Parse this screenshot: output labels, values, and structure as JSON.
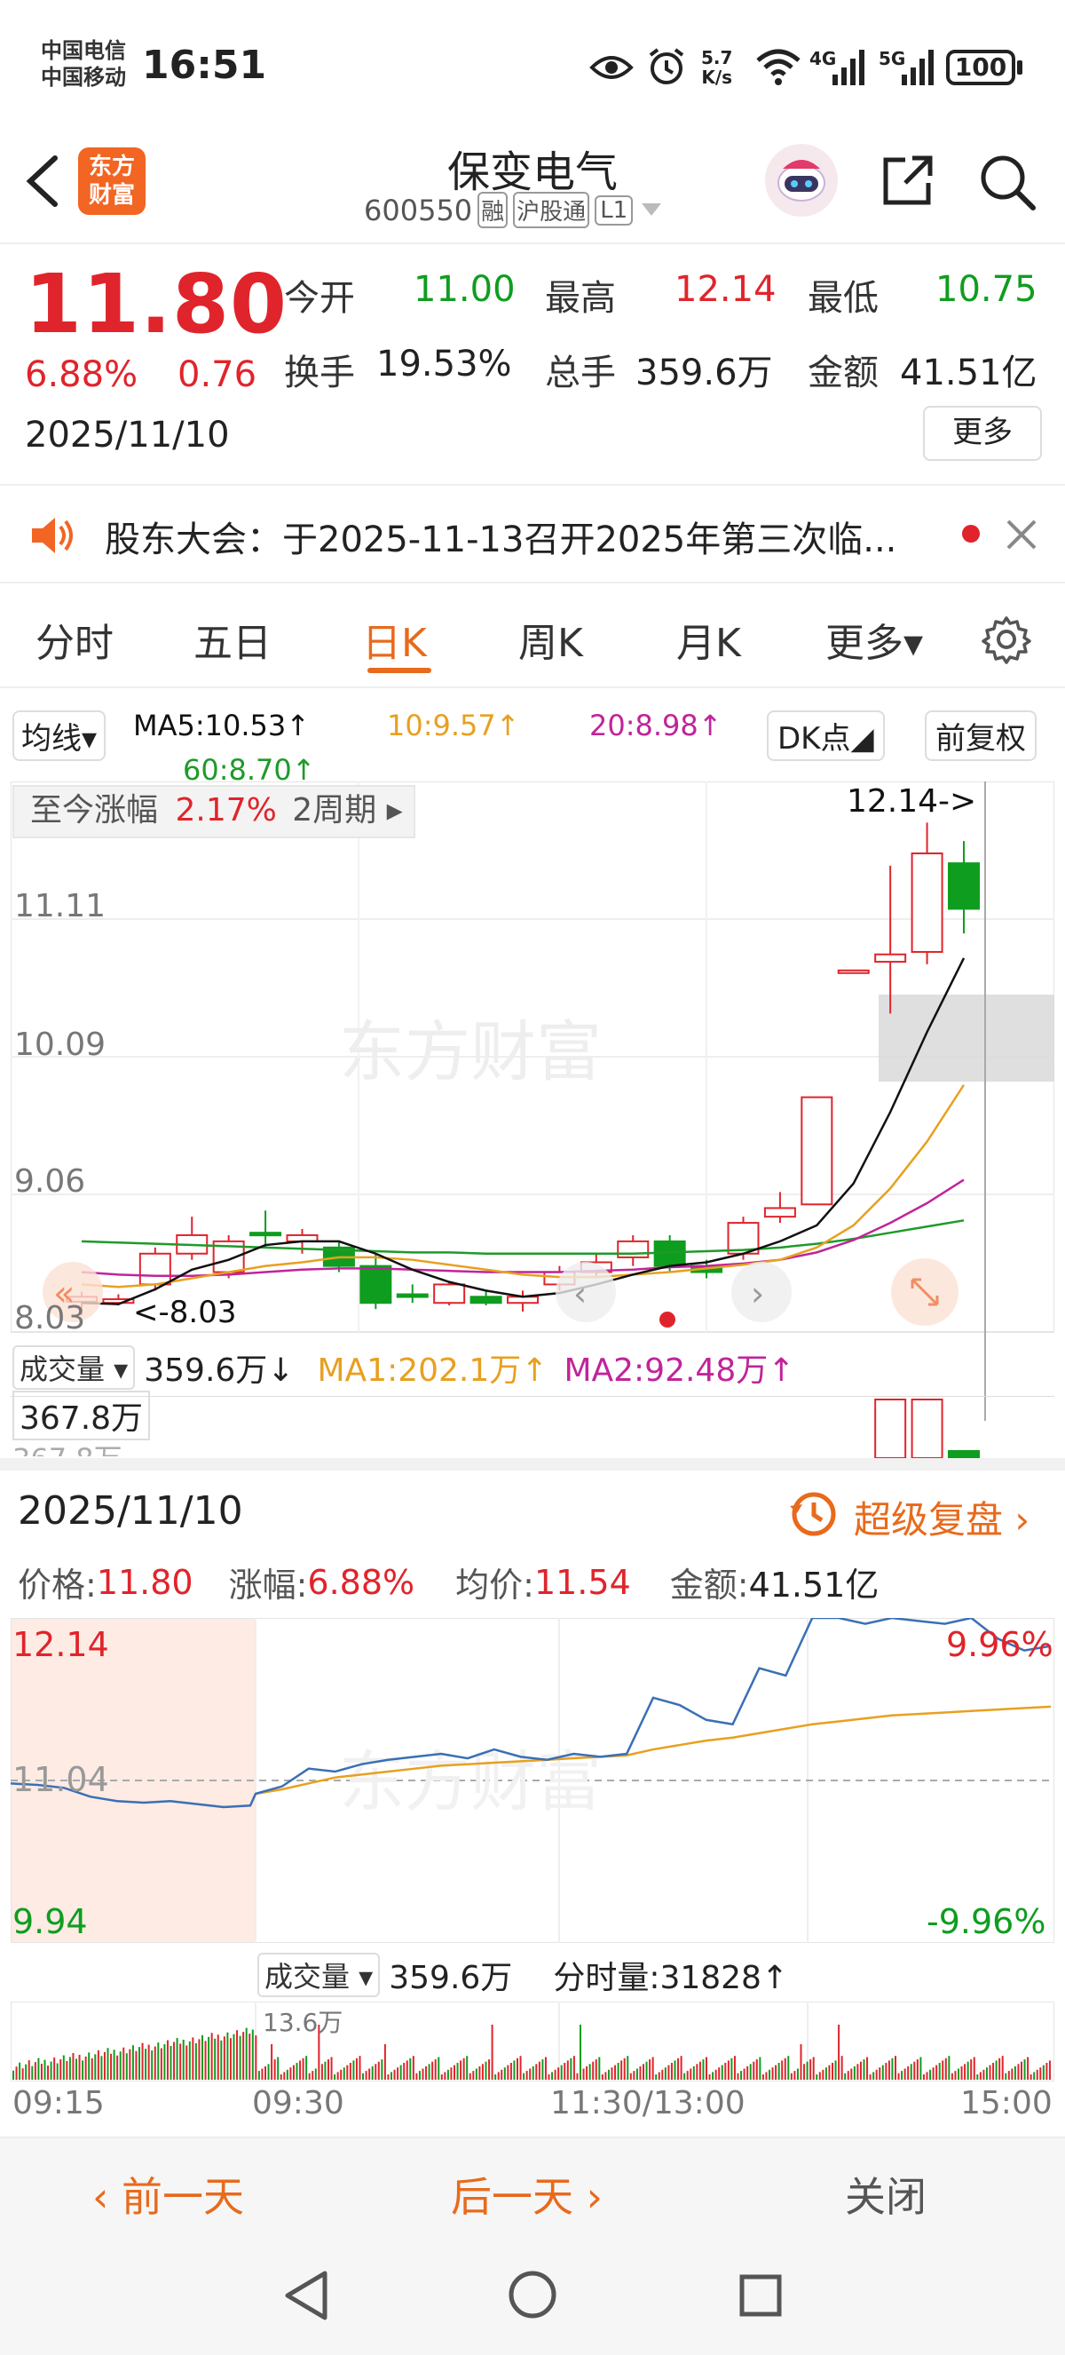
{
  "status_bar": {
    "carrier1": "中国电信",
    "carrier2": "中国移动",
    "time": "16:51",
    "net_speed_top": "5.7",
    "net_speed_bottom": "K/s",
    "sig1": "4G",
    "sig2": "5G",
    "battery": "100"
  },
  "header": {
    "logo_line1": "东方",
    "logo_line2": "财富",
    "stock_name": "保变电气",
    "stock_code": "600550",
    "tag_margin": "融",
    "tag_connect": "沪股通",
    "tag_level": "L1"
  },
  "quote": {
    "price": "11.80",
    "change_pct": "6.88%",
    "change_amt": "0.76",
    "date": "2025/11/10",
    "open_label": "今开",
    "open_value": "11.00",
    "high_label": "最高",
    "high_value": "12.14",
    "low_label": "最低",
    "low_value": "10.75",
    "turnover_label": "换手",
    "turnover_value": "19.53%",
    "volume_label": "总手",
    "volume_value": "359.6万",
    "amount_label": "金额",
    "amount_value": "41.51亿",
    "more_button": "更多"
  },
  "notice": {
    "text": "股东大会：于2025-11-13召开2025年第三次临..."
  },
  "tabs": {
    "items": [
      "分时",
      "五日",
      "日K",
      "周K",
      "月K",
      "更多▾"
    ],
    "active": "日K"
  },
  "kline": {
    "ma_selector": "均线▾",
    "ma5": "MA5:10.53↑",
    "ma10": "10:9.57↑",
    "ma20": "20:8.98↑",
    "ma60": "60:8.70↑",
    "dk_button": "DK点◢",
    "adjust_button": "前复权",
    "range_label": "至今涨幅",
    "range_value": "2.17%",
    "range_period": "2周期 ▸",
    "max_label": "12.14->",
    "min_label": "<-8.03",
    "y_labels": [
      "11.11",
      "10.09",
      "9.06",
      "8.03"
    ],
    "watermark": "东方财富",
    "vol_selector": "成交量 ▾",
    "vol_value": "359.6万↓",
    "vol_ma1": "MA1:202.1万↑",
    "vol_ma2": "MA2:92.48万↑",
    "vol_max": "367.8万",
    "vol_max_shadow": "367.8万",
    "colors": {
      "up": "#e0242b",
      "down": "#0f9d1f",
      "ma5": "#111111",
      "ma10": "#e8a020",
      "ma20": "#c0249a",
      "ma60": "#1f9a2a"
    }
  },
  "chart_data": {
    "type": "candlestick",
    "ylim": [
      8.03,
      12.14
    ],
    "candles": [
      {
        "o": 8.06,
        "c": 8.1,
        "h": 8.14,
        "l": 7.95
      },
      {
        "o": 8.05,
        "c": 8.08,
        "h": 8.12,
        "l": 8.03
      },
      {
        "o": 8.2,
        "c": 8.45,
        "h": 8.5,
        "l": 8.15
      },
      {
        "o": 8.45,
        "c": 8.6,
        "h": 8.75,
        "l": 8.4
      },
      {
        "o": 8.3,
        "c": 8.55,
        "h": 8.6,
        "l": 8.25
      },
      {
        "o": 8.62,
        "c": 8.6,
        "h": 8.8,
        "l": 8.5
      },
      {
        "o": 8.55,
        "c": 8.6,
        "h": 8.65,
        "l": 8.45
      },
      {
        "o": 8.5,
        "c": 8.35,
        "h": 8.55,
        "l": 8.3
      },
      {
        "o": 8.35,
        "c": 8.05,
        "h": 8.45,
        "l": 8.0
      },
      {
        "o": 8.12,
        "c": 8.1,
        "h": 8.2,
        "l": 8.05
      },
      {
        "o": 8.05,
        "c": 8.2,
        "h": 8.22,
        "l": 8.03
      },
      {
        "o": 8.1,
        "c": 8.05,
        "h": 8.15,
        "l": 8.03
      },
      {
        "o": 8.05,
        "c": 8.1,
        "h": 8.15,
        "l": 7.98
      },
      {
        "o": 8.2,
        "c": 8.3,
        "h": 8.35,
        "l": 8.15
      },
      {
        "o": 8.3,
        "c": 8.38,
        "h": 8.45,
        "l": 8.25
      },
      {
        "o": 8.42,
        "c": 8.55,
        "h": 8.6,
        "l": 8.35
      },
      {
        "o": 8.55,
        "c": 8.35,
        "h": 8.6,
        "l": 8.3
      },
      {
        "o": 8.35,
        "c": 8.3,
        "h": 8.4,
        "l": 8.25
      },
      {
        "o": 8.45,
        "c": 8.7,
        "h": 8.75,
        "l": 8.4
      },
      {
        "o": 8.75,
        "c": 8.82,
        "h": 8.95,
        "l": 8.7
      },
      {
        "o": 8.85,
        "c": 9.72,
        "h": 9.72,
        "l": 8.85
      },
      {
        "o": 10.75,
        "c": 10.75,
        "h": 10.75,
        "l": 10.75
      },
      {
        "o": 10.82,
        "c": 10.88,
        "h": 11.6,
        "l": 10.4
      },
      {
        "o": 10.9,
        "c": 11.7,
        "h": 11.95,
        "l": 10.8
      },
      {
        "o": 11.62,
        "c": 11.25,
        "h": 11.8,
        "l": 11.05
      }
    ],
    "ma5": [
      8.05,
      8.04,
      8.16,
      8.32,
      8.4,
      8.52,
      8.55,
      8.55,
      8.45,
      8.32,
      8.22,
      8.15,
      8.1,
      8.13,
      8.2,
      8.28,
      8.35,
      8.38,
      8.45,
      8.55,
      8.68,
      9.02,
      9.6,
      10.25,
      10.85
    ],
    "ma10": [
      8.2,
      8.18,
      8.2,
      8.25,
      8.3,
      8.35,
      8.38,
      8.42,
      8.42,
      8.4,
      8.36,
      8.32,
      8.28,
      8.26,
      8.26,
      8.28,
      8.3,
      8.33,
      8.36,
      8.4,
      8.5,
      8.68,
      8.98,
      9.36,
      9.82
    ],
    "ma20": [
      8.3,
      8.28,
      8.27,
      8.27,
      8.28,
      8.3,
      8.32,
      8.33,
      8.33,
      8.32,
      8.31,
      8.3,
      8.3,
      8.3,
      8.31,
      8.32,
      8.34,
      8.35,
      8.37,
      8.4,
      8.46,
      8.56,
      8.7,
      8.86,
      9.05
    ],
    "ma60": [
      8.55,
      8.54,
      8.53,
      8.52,
      8.51,
      8.5,
      8.49,
      8.48,
      8.47,
      8.46,
      8.46,
      8.45,
      8.45,
      8.45,
      8.45,
      8.45,
      8.46,
      8.47,
      8.48,
      8.5,
      8.53,
      8.57,
      8.62,
      8.67,
      8.72
    ],
    "volume_shown": [
      false,
      false,
      false,
      false,
      false,
      false,
      false,
      false,
      false,
      false,
      false,
      false,
      false,
      false,
      false,
      false,
      false,
      false,
      false,
      false,
      false,
      false,
      true,
      true,
      true
    ]
  },
  "minute": {
    "date": "2025/11/10",
    "replay_button": "超级复盘 ›",
    "price_label": "价格:",
    "price_value": "11.80",
    "chg_label": "涨幅:",
    "chg_value": "6.88%",
    "avg_label": "均价:",
    "avg_value": "11.54",
    "amt_label": "金额:",
    "amt_value": "41.51亿",
    "y_top": "12.14",
    "y_mid": "11.04",
    "y_bottom": "9.94",
    "pct_top": "9.96%",
    "pct_bottom": "-9.96%",
    "watermark": "东方财富",
    "vol_selector": "成交量 ▾",
    "vol_value": "359.6万",
    "tick_label": "分时量:31828↑",
    "vol_max": "13.6万",
    "time_labels": [
      "09:15",
      "09:30",
      "11:30/13:00",
      "15:00"
    ],
    "chart_data": {
      "type": "line",
      "ylim": [
        9.94,
        12.14
      ],
      "price": [
        11.02,
        11.01,
        10.99,
        10.93,
        10.9,
        10.89,
        10.9,
        10.88,
        10.86,
        10.87,
        10.95,
        11.0,
        11.12,
        11.1,
        11.15,
        11.18,
        11.2,
        11.22,
        11.19,
        11.25,
        11.2,
        11.18,
        11.22,
        11.2,
        11.22,
        11.6,
        11.55,
        11.45,
        11.42,
        11.8,
        11.75,
        12.14,
        12.14,
        12.1,
        12.14,
        12.12,
        12.1,
        12.14,
        12.0,
        11.92,
        11.95
      ],
      "average": [
        null,
        null,
        null,
        null,
        null,
        null,
        null,
        null,
        null,
        null,
        10.95,
        10.98,
        11.02,
        11.06,
        11.08,
        11.1,
        11.12,
        11.14,
        11.15,
        11.16,
        11.17,
        11.18,
        11.19,
        11.2,
        11.21,
        11.25,
        11.28,
        11.31,
        11.33,
        11.36,
        11.39,
        11.42,
        11.44,
        11.46,
        11.48,
        11.49,
        11.5,
        11.51,
        11.52,
        11.53,
        11.54
      ]
    }
  },
  "bottom": {
    "prev_day": "‹ 前一天",
    "next_day": "后一天 ›",
    "close": "关闭"
  }
}
